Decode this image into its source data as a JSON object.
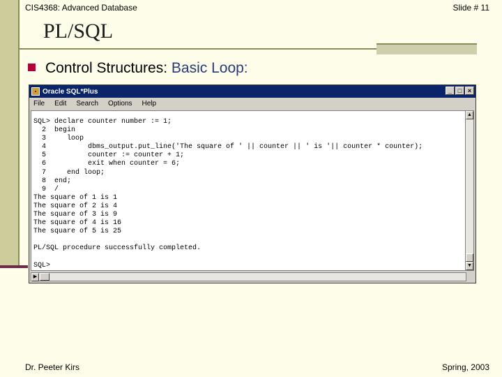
{
  "header": {
    "course": "CIS4368: Advanced Database",
    "slide_number": "Slide # 11"
  },
  "title": "PL/SQL",
  "bullet": {
    "prefix": "Control Structures: ",
    "topic": "Basic Loop:"
  },
  "window": {
    "title": "Oracle SQL*Plus",
    "controls": {
      "minimize": "_",
      "maximize": "□",
      "close": "×"
    },
    "menu": [
      "File",
      "Edit",
      "Search",
      "Options",
      "Help"
    ],
    "code_lines": [
      "SQL> declare counter number := 1;",
      "  2  begin",
      "  3     loop",
      "  4          dbms_output.put_line('The square of ' || counter || ' is '|| counter * counter);",
      "  5          counter := counter + 1;",
      "  6          exit when counter = 6;",
      "  7     end loop;",
      "  8  end;",
      "  9  /",
      "The square of 1 is 1",
      "The square of 2 is 4",
      "The square of 3 is 9",
      "The square of 4 is 16",
      "The square of 5 is 25",
      "",
      "PL/SQL procedure successfully completed.",
      "",
      "SQL>"
    ]
  },
  "footer": {
    "author": "Dr. Peeter Kirs",
    "term": "Spring, 2003"
  },
  "colors": {
    "slide_background": "#fdfde9",
    "bullet_marker": "#b3003b",
    "topic_text": "#2a3a78",
    "window_titlebar": "#0a246a"
  }
}
